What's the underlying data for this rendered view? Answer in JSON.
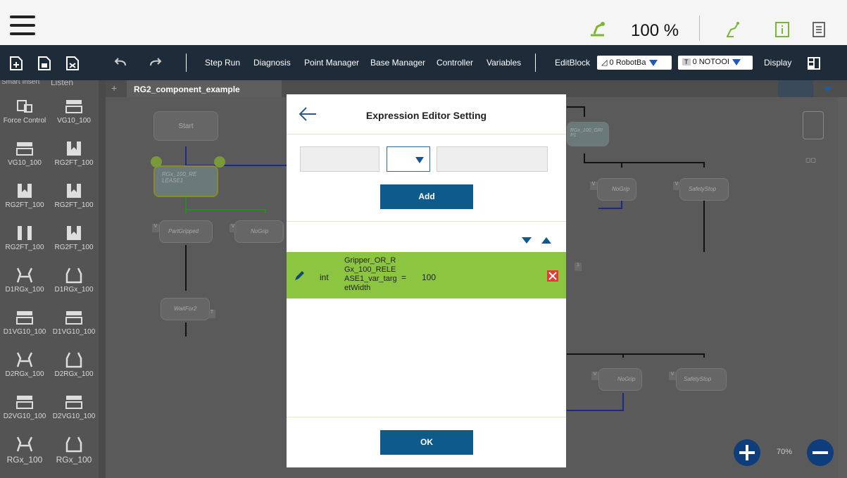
{
  "topbar": {
    "speed": "100 %"
  },
  "toolbar": {
    "step_run": "Step Run",
    "diagnosis": "Diagnosis",
    "point_manager": "Point Manager",
    "base_manager": "Base Manager",
    "controller": "Controller",
    "variables": "Variables",
    "edit_block": "EditBlock",
    "base_select": "0 RobotBa",
    "tool_select": "0 NOTOOI",
    "display": "Display"
  },
  "left_panel": {
    "tabs": [
      "Smart Insert",
      "Listen"
    ],
    "items": [
      "Force Control",
      "VG10_100",
      "VG10_100",
      "RG2FT_100",
      "RG2FT_100",
      "RG2FT_100",
      "RG2FT_100",
      "RG2FT_100",
      "D1RGx_100",
      "D1RGx_100",
      "D1VG10_100",
      "D1VG10_100",
      "D2RGx_100",
      "D2RGx_100",
      "D2VG10_100",
      "D2VG10_100",
      "RGx_100",
      "RGx_100"
    ]
  },
  "canvas": {
    "tab": "RG2_component_example",
    "nodes": {
      "start": "Start",
      "release": "RGx_100_RE LEASE1",
      "part_gripped": "PartGripped",
      "no_grip": "NoGrip",
      "wait_for": "WaitFor2",
      "grip": "RGx_100_GRI P1",
      "no_grip_2": "NoGrip",
      "safety_stop": "SafetyStop",
      "no_grip_3": "NoGrip",
      "safety_stop_2": "SafetyStop"
    },
    "badge_v": "V",
    "badge_t": "T",
    "badge_one": "1",
    "zoom": "70%"
  },
  "modal": {
    "title": "Expression Editor Setting",
    "add_label": "Add",
    "ok_label": "OK",
    "row": {
      "type": "int",
      "name": "Gripper_OR_RGx_100_RELEASE1_var_targetWidth",
      "op": "=",
      "value": "100"
    }
  },
  "colors": {
    "toolbar": "#1e2c3a",
    "accent_blue": "#0e5a8a",
    "row_green": "#8cc53f",
    "delete_red": "#e53935"
  }
}
